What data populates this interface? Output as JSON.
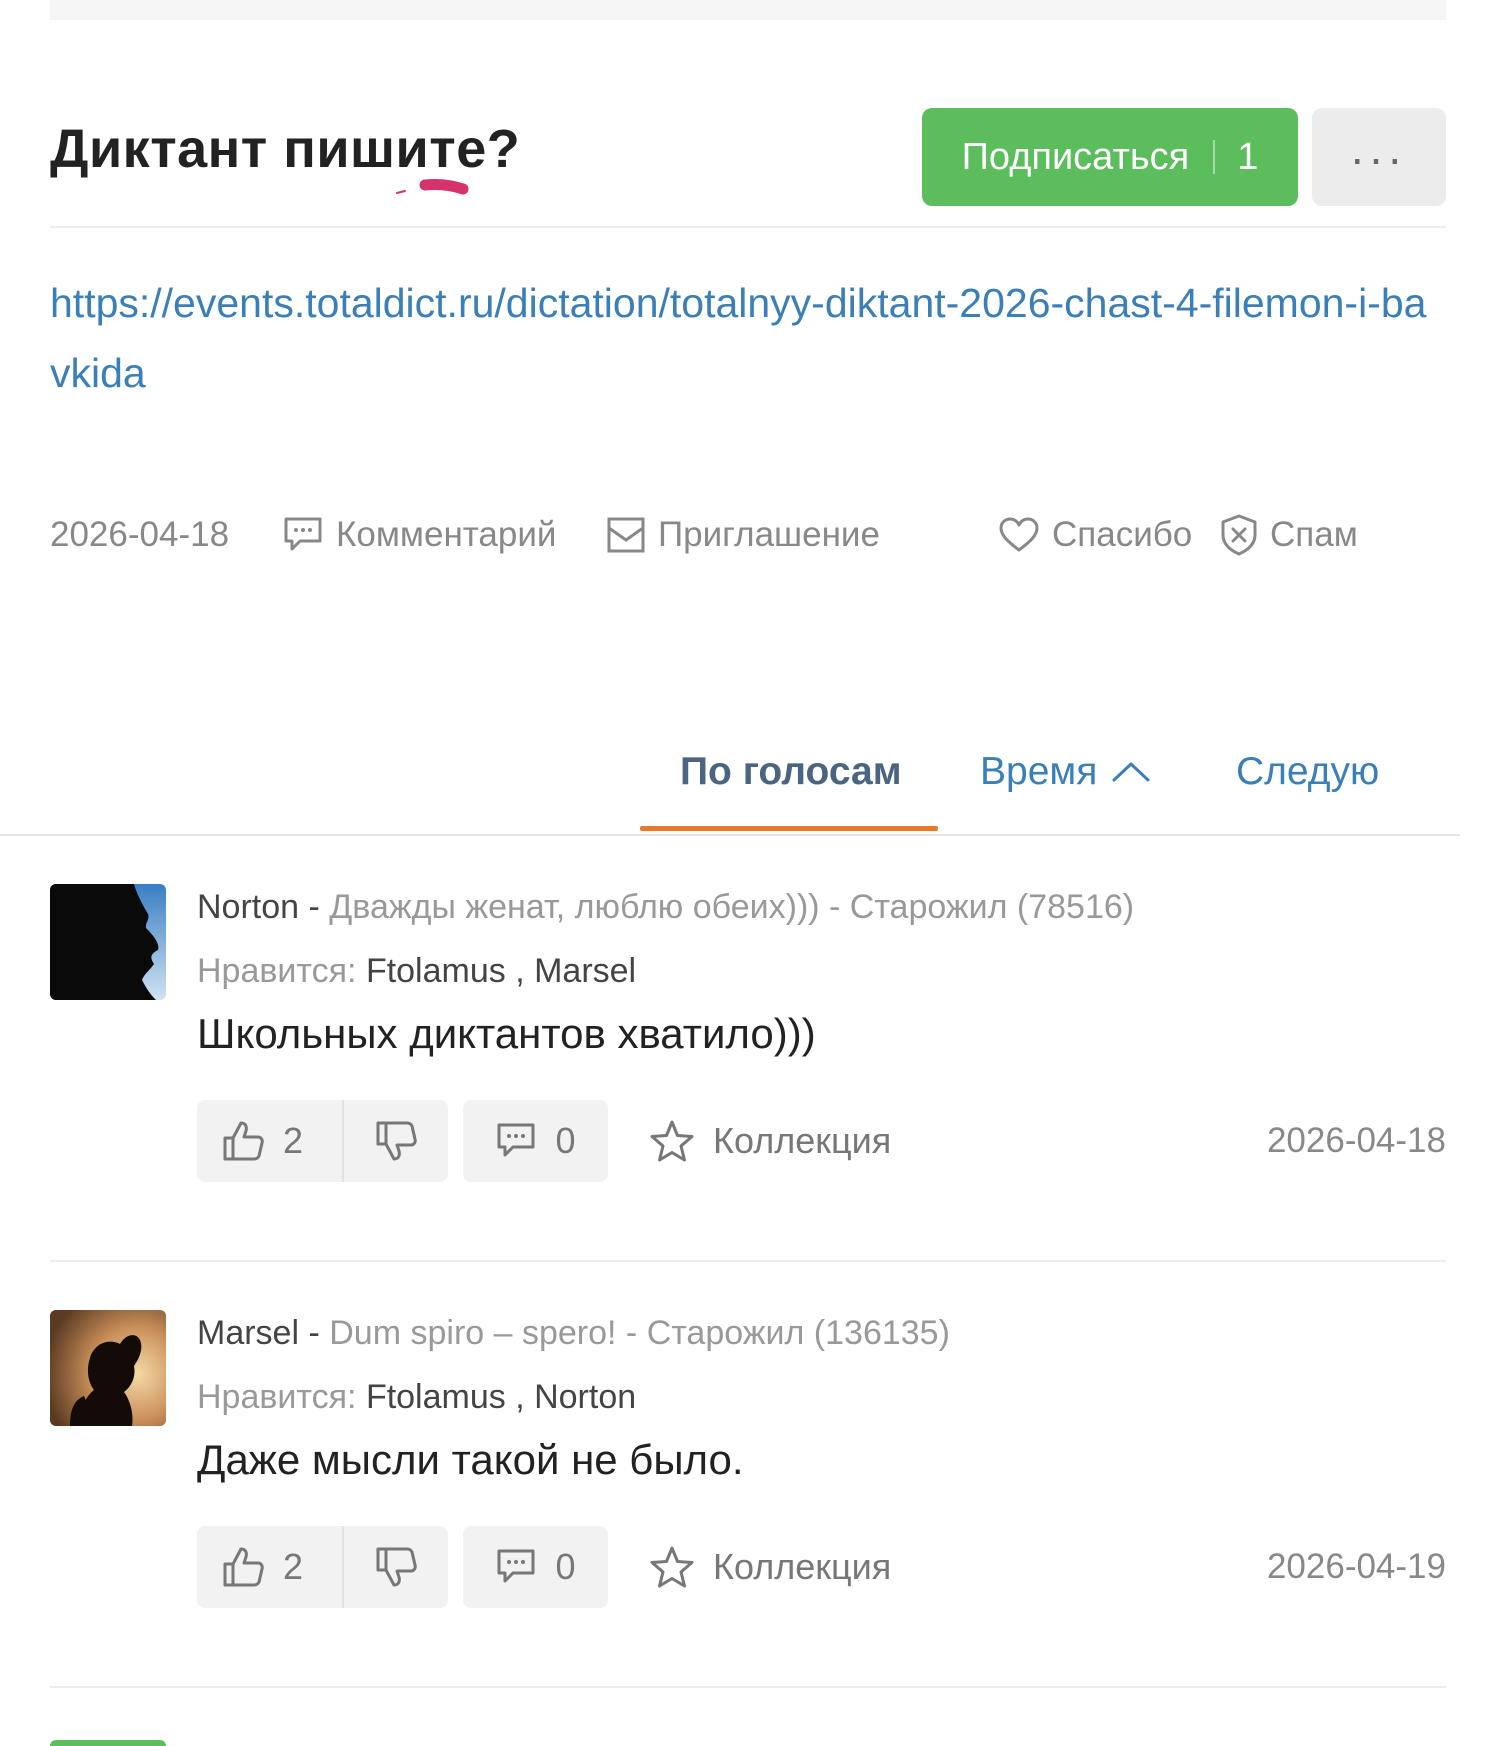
{
  "post": {
    "title": "Диктант пишите?",
    "subscribe_label": "Подписаться",
    "subscribe_count": "1",
    "more_label": "...",
    "link": "https://events.totaldict.ru/dictation/totalnyy-diktant-2026-chast-4-filemon-i-bavkida"
  },
  "meta": {
    "date": "2026-04-18",
    "comment_label": "Комментарий",
    "invite_label": "Приглашение",
    "thanks_label": "Спасибо",
    "spam_label": "Спам"
  },
  "sort_tabs": {
    "votes": "По голосам",
    "time": "Время",
    "following": "Следую"
  },
  "comments": [
    {
      "author": "Norton",
      "separator": " - ",
      "subtitle": "Дважды женат, люблю обеих))) - Старожил (78516)",
      "likes_label": "Нравится:",
      "likes_names": "Ftolamus , Marsel",
      "text": "Школьных диктантов хватило)))",
      "upvotes": "2",
      "replies": "0",
      "collection_label": "Коллекция",
      "date": "2026-04-18"
    },
    {
      "author": "Marsel",
      "separator": " - ",
      "subtitle": "Dum spiro – spero! - Старожил (136135)",
      "likes_label": "Нравится:",
      "likes_names": "Ftolamus , Norton",
      "text": "Даже мысли такой не было.",
      "upvotes": "2",
      "replies": "0",
      "collection_label": "Коллекция",
      "date": "2026-04-19"
    }
  ],
  "colors": {
    "accent_green": "#5cbd5c",
    "link_blue": "#3b7fb8",
    "tab_active_underline": "#e8792b"
  },
  "icons": [
    "comment-icon",
    "envelope-icon",
    "heart-icon",
    "shield-x-icon",
    "chevron-up-icon",
    "thumbs-up-icon",
    "thumbs-down-icon",
    "star-icon"
  ]
}
